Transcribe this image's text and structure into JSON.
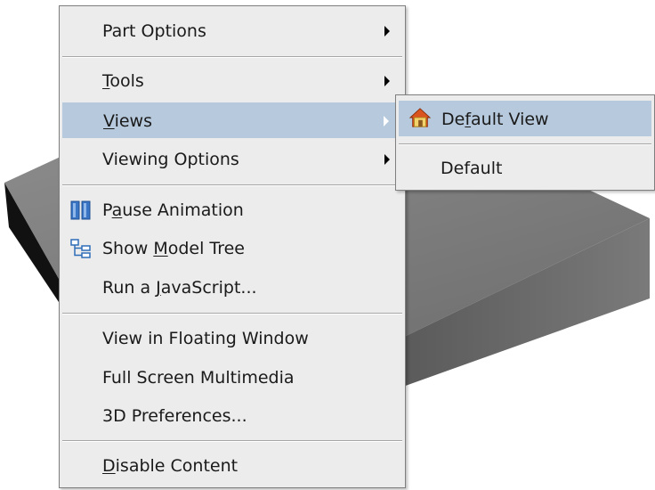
{
  "main_menu": {
    "items": [
      {
        "label_pre": "Part Options",
        "mnemonic": "",
        "label_post": "",
        "has_submenu": true
      },
      {
        "label_pre": "",
        "mnemonic": "T",
        "label_post": "ools",
        "has_submenu": true
      },
      {
        "label_pre": "",
        "mnemonic": "V",
        "label_post": "iews",
        "has_submenu": true
      },
      {
        "label_pre": "Viewing Options",
        "mnemonic": "",
        "label_post": "",
        "has_submenu": true
      },
      {
        "label_pre": "P",
        "mnemonic": "a",
        "label_post": "use Animation",
        "icon": "pause-icon"
      },
      {
        "label_pre": "Show ",
        "mnemonic": "M",
        "label_post": "odel Tree",
        "icon": "model-tree-icon"
      },
      {
        "label_pre": "Run a ",
        "mnemonic": "J",
        "label_post": "avaScript...",
        "icon": ""
      },
      {
        "label_pre": "View in Floating Window",
        "mnemonic": "",
        "label_post": ""
      },
      {
        "label_pre": "Full Screen Multimedia",
        "mnemonic": "",
        "label_post": ""
      },
      {
        "label_pre": "3D Preferences...",
        "mnemonic": "",
        "label_post": ""
      },
      {
        "label_pre": "",
        "mnemonic": "D",
        "label_post": "isable Content"
      }
    ],
    "highlighted_index": 2
  },
  "sub_menu": {
    "items": [
      {
        "label_pre": "De",
        "mnemonic": "f",
        "label_post": "ault View",
        "icon": "home-icon"
      },
      {
        "label_pre": "Default",
        "mnemonic": "",
        "label_post": ""
      }
    ],
    "highlighted_index": 0
  },
  "colors": {
    "menu_bg": "#ececec",
    "highlight": "#b7c9dc",
    "box_top": "#7a7a7a",
    "box_front": "#6a6a6a",
    "box_side": "#111111"
  }
}
